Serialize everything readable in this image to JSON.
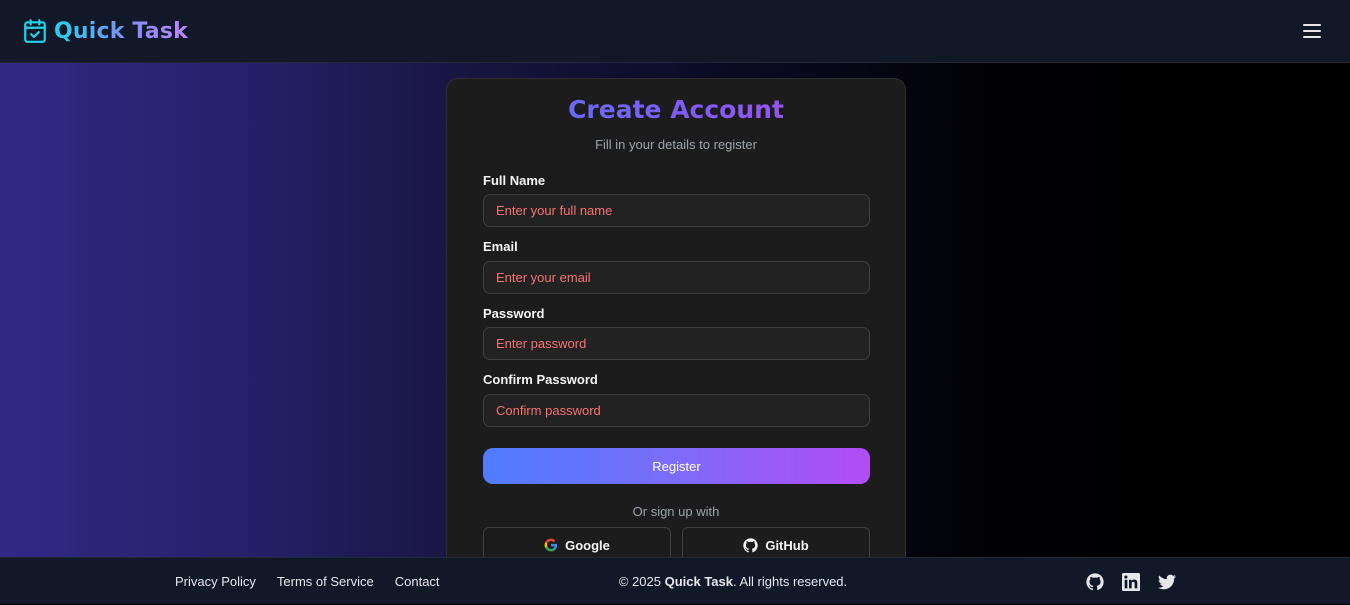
{
  "navbar": {
    "brand": "Quick Task",
    "brand_icon": "calendar-check-icon",
    "menu_icon": "hamburger-menu-icon"
  },
  "form": {
    "title": "Create Account",
    "subtitle": "Fill in your details to register",
    "fields": [
      {
        "label": "Full Name",
        "placeholder": "Enter your full name",
        "value": ""
      },
      {
        "label": "Email",
        "placeholder": "Enter your email",
        "value": ""
      },
      {
        "label": "Password",
        "placeholder": "Enter password",
        "value": ""
      },
      {
        "label": "Confirm Password",
        "placeholder": "Confirm password",
        "value": ""
      }
    ],
    "register_label": "Register",
    "or_text": "Or sign up with",
    "google_label": "Google",
    "github_label": "GitHub"
  },
  "footer": {
    "links": [
      "Privacy Policy",
      "Terms of Service",
      "Contact"
    ],
    "copyright_prefix": "© 2025 ",
    "copyright_brand": "Quick Task",
    "copyright_suffix": ". All rights reserved.",
    "social_icons": [
      "github-icon",
      "linkedin-icon",
      "twitter-icon"
    ]
  },
  "colors": {
    "accent_blue": "#4f7cff",
    "accent_purple": "#b44cf5",
    "placeholder": "#f87171",
    "nav_bg": "#111827"
  }
}
